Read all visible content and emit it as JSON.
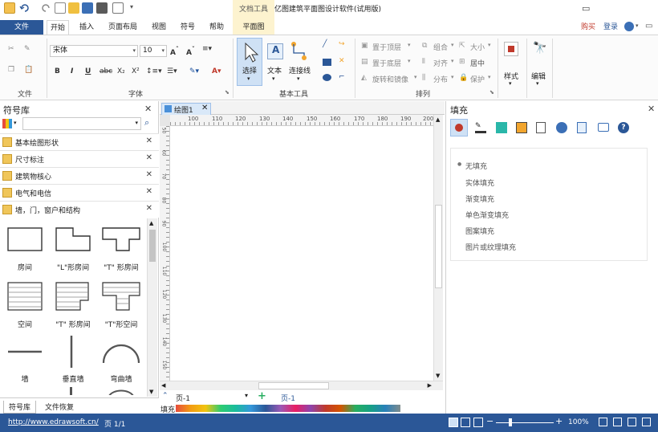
{
  "title_bar": {
    "context_tab": "文档工具",
    "title": "亿图建筑平面图设计软件(试用版)"
  },
  "tabs": [
    {
      "label": "文件"
    },
    {
      "label": "开始"
    },
    {
      "label": "插入"
    },
    {
      "label": "页面布局"
    },
    {
      "label": "视图"
    },
    {
      "label": "符号"
    },
    {
      "label": "帮助"
    },
    {
      "label": "平面图"
    }
  ],
  "account": {
    "buy": "购买",
    "login": "登录"
  },
  "ribbon": {
    "file_group": {
      "label": "文件"
    },
    "font_group": {
      "label": "字体",
      "font_name": "宋体",
      "font_size": "10"
    },
    "basic_tools": {
      "label": "基本工具",
      "select": "选择",
      "text": "文本",
      "connector": "连接线"
    },
    "arrange": {
      "label": "排列",
      "bring_front": "置于顶层",
      "send_back": "置于底层",
      "rotate_mirror": "旋转和镜像",
      "group": "组合",
      "align": "对齐",
      "distribute": "分布",
      "size": "大小",
      "center": "居中",
      "protect": "保护"
    },
    "style": {
      "label": "样式"
    },
    "edit": {
      "label": "编辑"
    }
  },
  "left_panel": {
    "title": "符号库",
    "libraries": [
      {
        "label": "基本绘图形状"
      },
      {
        "label": "尺寸标注"
      },
      {
        "label": "建筑物核心"
      },
      {
        "label": "电气和电信"
      },
      {
        "label": "墙，门，窗户和结构"
      }
    ],
    "shapes": [
      {
        "label": "房间"
      },
      {
        "label": "\"L\"形房间"
      },
      {
        "label": "\"T\" 形房间"
      },
      {
        "label": "空间"
      },
      {
        "label": "\"T\" 形房间"
      },
      {
        "label": "\"T\"形空间"
      },
      {
        "label": "墙"
      },
      {
        "label": "垂直墙"
      },
      {
        "label": "弯曲墙"
      }
    ],
    "bottom_tabs": [
      {
        "label": "符号库"
      },
      {
        "label": "文件恢复"
      }
    ]
  },
  "document": {
    "tab": "绘图1",
    "ruler_top": [
      "100",
      "110",
      "120",
      "130",
      "140",
      "150",
      "160",
      "170",
      "180",
      "190",
      "200"
    ],
    "ruler_left": [
      "50",
      "60",
      "70",
      "80",
      "90",
      "100",
      "110",
      "120",
      "130",
      "140",
      "150"
    ],
    "page_selector": "页-1",
    "active_page": "页-1",
    "fill_label": "填充"
  },
  "right_panel": {
    "title": "填充",
    "options": [
      {
        "label": "无填充"
      },
      {
        "label": "实体填充"
      },
      {
        "label": "渐变填充"
      },
      {
        "label": "单色渐变填充"
      },
      {
        "label": "图案填充"
      },
      {
        "label": "图片或纹理填充"
      }
    ]
  },
  "status": {
    "url": "http://www.edrawsoft.cn/",
    "page": "页 1/1",
    "zoom": "100%"
  },
  "colors": {
    "accent": "#2b5797",
    "context_tab": "#fdf3cf"
  }
}
